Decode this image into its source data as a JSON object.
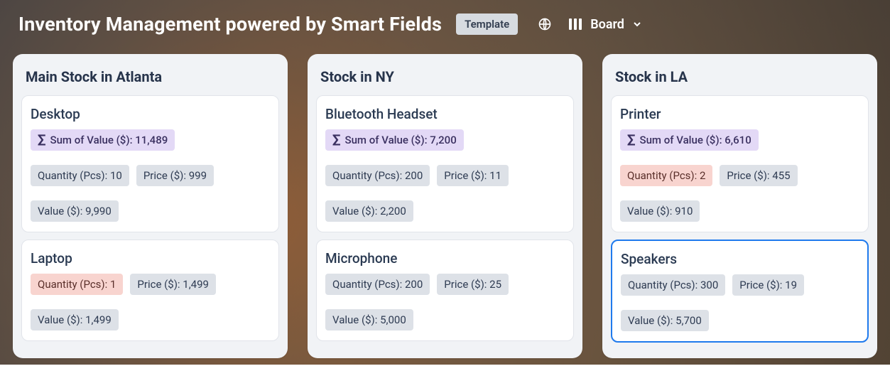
{
  "header": {
    "title": "Inventory Management powered by Smart Fields",
    "template_badge": "Template",
    "view_label": "Board"
  },
  "labels": {
    "sum_prefix": "Sum of Value ($):",
    "qty_prefix": "Quantity (Pcs):",
    "price_prefix": "Price ($):",
    "value_prefix": "Value ($):"
  },
  "columns": [
    {
      "title": "Main Stock in Atlanta",
      "cards": [
        {
          "title": "Desktop",
          "sum": "11,489",
          "qty": "10",
          "price": "999",
          "value": "9,990",
          "qty_low": false,
          "selected": false
        },
        {
          "title": "Laptop",
          "sum": null,
          "qty": "1",
          "price": "1,499",
          "value": "1,499",
          "qty_low": true,
          "selected": false
        }
      ]
    },
    {
      "title": "Stock in NY",
      "cards": [
        {
          "title": "Bluetooth Headset",
          "sum": "7,200",
          "qty": "200",
          "price": "11",
          "value": "2,200",
          "qty_low": false,
          "selected": false
        },
        {
          "title": "Microphone",
          "sum": null,
          "qty": "200",
          "price": "25",
          "value": "5,000",
          "qty_low": false,
          "selected": false
        }
      ]
    },
    {
      "title": "Stock in LA",
      "cards": [
        {
          "title": "Printer",
          "sum": "6,610",
          "qty": "2",
          "price": "455",
          "value": "910",
          "qty_low": true,
          "selected": false
        },
        {
          "title": "Speakers",
          "sum": null,
          "qty": "300",
          "price": "19",
          "value": "5,700",
          "qty_low": false,
          "selected": true
        }
      ]
    }
  ]
}
